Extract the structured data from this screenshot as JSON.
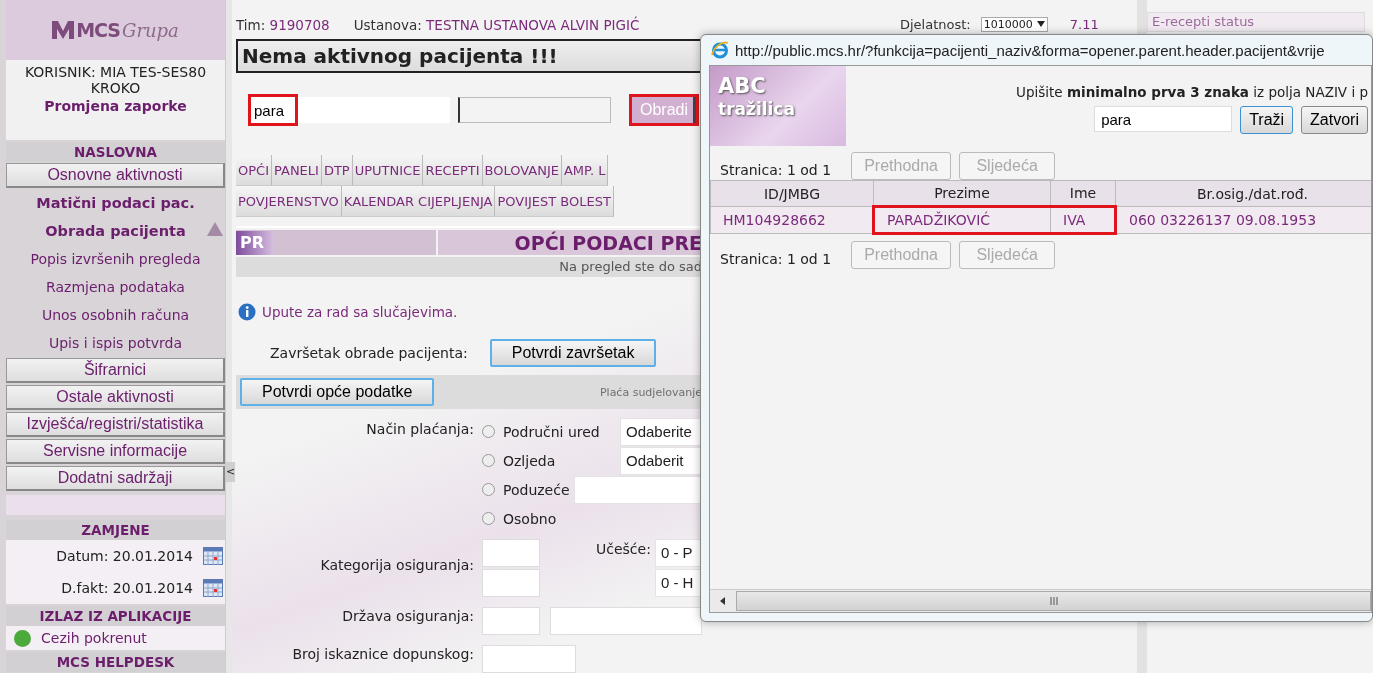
{
  "sidebar": {
    "logo": {
      "mark": "MCS",
      "script": "Grupa"
    },
    "user": [
      "KORISNIK: MIA TES-SES80",
      "KROKO"
    ],
    "change_password": "Promjena zaporke",
    "items": [
      {
        "kind": "header",
        "label": "NASLOVNA"
      },
      {
        "kind": "button",
        "label": "Osnovne aktivnosti"
      },
      {
        "kind": "link",
        "label": "Matični podaci pac.",
        "bold": true
      },
      {
        "kind": "link",
        "label": "Obrada pacijenta",
        "bold": true,
        "expanded": true
      },
      {
        "kind": "link",
        "label": "Popis izvršenih pregleda",
        "bold": false
      },
      {
        "kind": "link",
        "label": "Razmjena podataka",
        "bold": false
      },
      {
        "kind": "link",
        "label": "Unos osobnih računa",
        "bold": false
      },
      {
        "kind": "link",
        "label": "Upis i ispis potvrda",
        "bold": false
      },
      {
        "kind": "button",
        "label": "Šifrarnici"
      },
      {
        "kind": "button",
        "label": "Ostale aktivnosti"
      },
      {
        "kind": "button",
        "label": "Izvješća/registri/statistika"
      },
      {
        "kind": "button",
        "label": "Servisne informacije"
      },
      {
        "kind": "button",
        "label": "Dodatni sadržaji"
      },
      {
        "kind": "spacer"
      },
      {
        "kind": "header",
        "label": "ZAMJENE"
      },
      {
        "kind": "date",
        "label": "Datum:",
        "value": "20.01.2014"
      },
      {
        "kind": "date",
        "label": "D.fakt:",
        "value": "20.01.2014"
      },
      {
        "kind": "header",
        "label": "IZLAZ IZ APLIKACIJE"
      },
      {
        "kind": "status",
        "label": "Cezih pokrenut",
        "on": true
      },
      {
        "kind": "header",
        "label": "MCS HELPDESK"
      }
    ]
  },
  "splitter": {
    "arrow": "<"
  },
  "header": {
    "team_label": "Tim:",
    "team": "9190708",
    "institution_label": "Ustanova:",
    "institution": "TESTNA USTANOVA ALVIN PIGIĆ",
    "activity_label": "Djelatnost:",
    "activity": "1010000",
    "version": "7.11"
  },
  "patient_banner": "Nema aktivnog pacijenta !!!",
  "search": {
    "value": "para",
    "highlighted": true
  },
  "process_button": {
    "label": "Obradi",
    "highlighted": true
  },
  "tab_rows": [
    [
      {
        "label": "OPĆI"
      },
      {
        "label": "PANELI"
      },
      {
        "label": "DTP"
      },
      {
        "label": "UPUTNICE"
      },
      {
        "label": "RECEPTI"
      },
      {
        "label": "BOLOVANJE"
      },
      {
        "label": "AMP. L"
      }
    ],
    [
      {
        "label": "POVJERENSTVO"
      },
      {
        "label": "KALENDAR CIJEPLJENJA"
      },
      {
        "label": "POVIJEST BOLEST"
      }
    ]
  ],
  "section": {
    "badge": "PR",
    "title": "OPĆI PODACI PRE",
    "notice": "Na pregled ste do sad"
  },
  "info_link": "Upute za rad sa slučajevima.",
  "finish": {
    "label": "Završetak obrade pacijenta:",
    "button": "Potvrdi završetak"
  },
  "confirm": {
    "button": "Potvrdi opće podatke",
    "note": "Plaća sudjelovanje"
  },
  "payment": {
    "label": "Način plaćanja:",
    "options": [
      {
        "label": "Područni ured",
        "selected": false,
        "kind": "select",
        "value": "Odaberite"
      },
      {
        "label": "Ozljeda",
        "selected": false,
        "kind": "select",
        "value": "Odaberit"
      },
      {
        "label": "Poduzeće",
        "selected": false,
        "kind": "input"
      },
      {
        "label": "Osobno",
        "selected": false,
        "kind": "none"
      }
    ]
  },
  "insurance": {
    "label": "Kategorija osiguranja:",
    "share_label": "Učešće:",
    "share_values": [
      "0 - P",
      "0 - H"
    ]
  },
  "country": {
    "label": "Država osiguranja:"
  },
  "card": {
    "label": "Broj iskaznice dopunskog:"
  },
  "right_panel": {
    "title": "E-recepti status"
  },
  "popup": {
    "url": "http://public.mcs.hr/?funkcija=pacijenti_naziv&forma=opener.parent.header.pacijent&vrije",
    "logo": [
      "ABC",
      "tražilica"
    ],
    "instruction": "Upišite **minimalno prva 3 znaka** iz polja NAZIV i p",
    "query": "para",
    "buttons": [
      "Traži",
      "Zatvori"
    ],
    "pagers": [
      {
        "label": "Stranica: 1 od 1",
        "buttons": [
          {
            "label": "Prethodna",
            "disabled": true
          },
          {
            "label": "Sljedeća",
            "disabled": true
          }
        ]
      },
      {
        "label": "Stranica: 1 od 1",
        "buttons": [
          {
            "label": "Prethodna",
            "disabled": true
          },
          {
            "label": "Sljedeća",
            "disabled": true
          }
        ]
      }
    ],
    "table": {
      "columns": [
        "ID/JMBG",
        "Prezime",
        "Ime",
        "Br.osig./dat.rođ."
      ],
      "rows": [
        {
          "cells": [
            "HM104928662",
            "PARADŽIKOVIĆ",
            "IVA",
            "060 03226137 09.08.1953"
          ],
          "highlighted": true
        }
      ]
    }
  }
}
